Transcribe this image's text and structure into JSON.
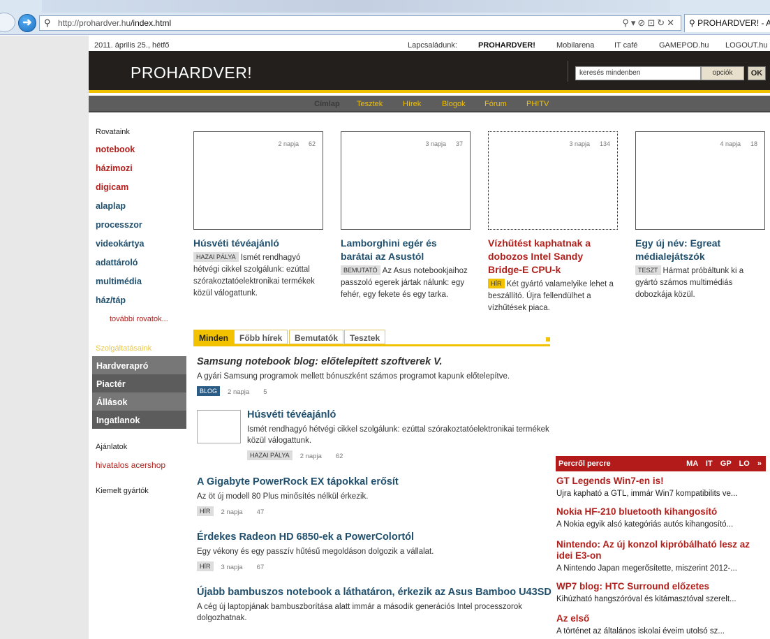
{
  "browser": {
    "url_host": "http://prohardver.hu",
    "url_path": "/index.html",
    "tab_title": "PROHARDVER! - A"
  },
  "top": {
    "date": "2011. április 25., hétfő",
    "family_label": "Lapcsaládunk:",
    "links": [
      "PROHARDVER!",
      "Mobilarena",
      "IT café",
      "GAMEPOD.hu",
      "LOGOUT.hu"
    ]
  },
  "header": {
    "logo": "PROHARDVER!",
    "search_placeholder": "keresés mindenben",
    "options_label": "opciók",
    "ok_label": "OK"
  },
  "nav": [
    "Címlap",
    "Tesztek",
    "Hírek",
    "Blogok",
    "Fórum",
    "PH!TV"
  ],
  "sidebar": {
    "rovataink_label": "Rovataink",
    "rovatok": [
      "notebook",
      "házimozi",
      "digicam",
      "alaplap",
      "processzor",
      "videokártya",
      "adattároló",
      "multimédia",
      "ház/táp"
    ],
    "more_label": "további rovatok...",
    "szolg_label": "Szolgáltatásaink",
    "services": [
      "Hardverapró",
      "Piactér",
      "Állások",
      "Ingatlanok"
    ],
    "ajanlatok_label": "Ajánlatok",
    "acershop": "hivatalos acershop",
    "kiemelt_label": "Kiemelt gyártók"
  },
  "featured": [
    {
      "age": "2 napja",
      "comments": "62",
      "title": "Húsvéti tévéajánló",
      "tag": "HAZAI PÁLYA",
      "text": "Ismét rendhagyó hétvégi cikkel szolgálunk: ezúttal szórakoztatóelektronikai termékek közül válogattunk."
    },
    {
      "age": "3 napja",
      "comments": "37",
      "title": "Lamborghini egér és barátai az Asustól",
      "tag": "BEMUTATÓ",
      "text": "Az Asus notebookjaihoz passzoló egerek jártak nálunk: egy fehér, egy fekete és egy tarka."
    },
    {
      "age": "3 napja",
      "comments": "134",
      "title": "Vízhűtést kaphatnak a dobozos Intel Sandy Bridge-E CPU-k",
      "tag": "HÍR",
      "text": "Két gyártó valamelyike lehet a beszállító. Újra fellendülhet a vízhűtések piaca."
    },
    {
      "age": "4 napja",
      "comments": "18",
      "title": "Egy új név: Egreat médialejátszók",
      "tag": "TESZT",
      "text": "Hármat próbáltunk ki a gyártó számos multimédiás dobozkája közül."
    }
  ],
  "tabs": [
    "Minden",
    "Főbb hírek",
    "Bemutatók",
    "Tesztek"
  ],
  "news": [
    {
      "title": "Samsung notebook blog: előtelepített szoftverek V.",
      "text": "A gyári Samsung programok mellett bónuszként számos programot kapunk előtelepítve.",
      "tag": "BLOG",
      "age": "2 napja",
      "comments": "5"
    },
    {
      "title": "Húsvéti tévéajánló",
      "text": "Ismét rendhagyó hétvégi cikkel szolgálunk: ezúttal szórakoztatóelektronikai termékek közül válogattunk.",
      "tag": "HAZAI PÁLYA",
      "age": "2 napja",
      "comments": "62"
    },
    {
      "title": "A Gigabyte PowerRock EX tápokkal erősít",
      "text": "Az öt új modell 80 Plus minősítés nélkül érkezik.",
      "tag": "HÍR",
      "age": "2 napja",
      "comments": "47"
    },
    {
      "title": "Érdekes Radeon HD 6850-ek a PowerColortól",
      "text": "Egy vékony és egy passzív hűtésű megoldáson dolgozik a vállalat.",
      "tag": "HÍR",
      "age": "3 napja",
      "comments": "67"
    },
    {
      "title": "Újabb bambuszos notebook a láthatáron, érkezik az Asus Bamboo U43SD",
      "text": "A cég új laptopjának bambuszborítása alatt immár a második generációs Intel processzorok dolgozhatnak."
    }
  ],
  "percrol": {
    "title": "Percről percre",
    "tabs": [
      "MA",
      "IT",
      "GP",
      "LO",
      "»"
    ],
    "items": [
      {
        "title": "GT Legends Win7-en is!",
        "text": "Újra kapható a GTL, immár Win7 kompatibilits ve..."
      },
      {
        "title": "Nokia HF-210 bluetooth kihangosító",
        "text": "A Nokia egyik alsó kategóriás autós kihangosító..."
      },
      {
        "title": "Nintendo: Az új konzol kipróbálható lesz az idei E3-on",
        "text": "A Nintendo Japan megerősítette, miszerint 2012-..."
      },
      {
        "title": "WP7 blog: HTC Surround előzetes",
        "text": "Kihúzható hangszóróval és kitámasztóval szerelt..."
      },
      {
        "title": "Az első",
        "text": "A történet az általános iskolai éveim utolsó sz..."
      }
    ]
  }
}
